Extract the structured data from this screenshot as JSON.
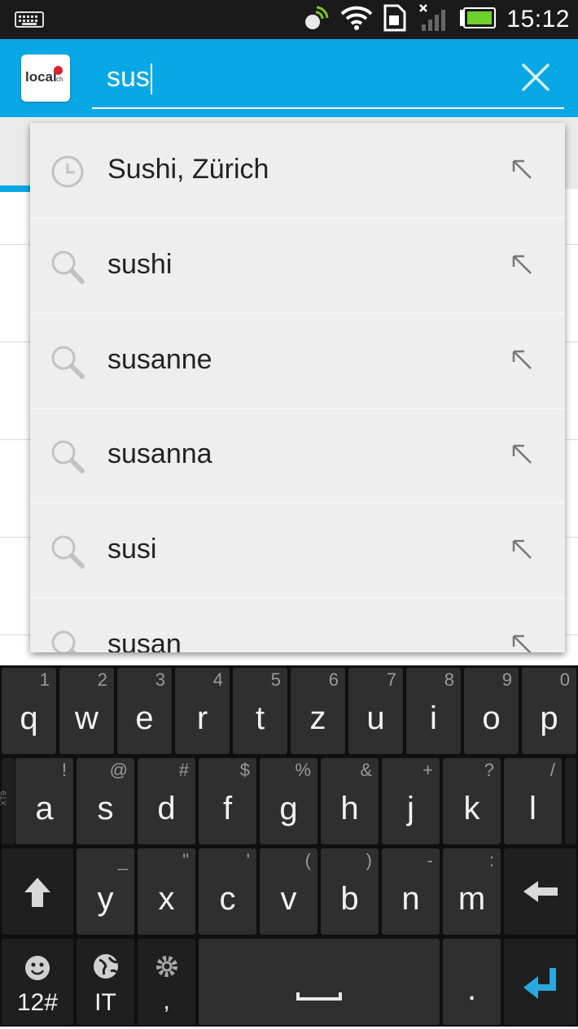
{
  "status_bar": {
    "time": "15:12",
    "icons": [
      "keyboard-icon",
      "nfc-icon",
      "wifi-icon",
      "sim-icon",
      "signal-icon",
      "battery-icon"
    ]
  },
  "search": {
    "value": "sus",
    "logo_text": "local",
    "logo_suffix": "ch"
  },
  "suggestions": [
    {
      "text": "Sushi, Zürich",
      "icon": "history-clock-icon"
    },
    {
      "text": "sushi",
      "icon": "search-icon"
    },
    {
      "text": "susanne",
      "icon": "search-icon"
    },
    {
      "text": "susanna",
      "icon": "search-icon"
    },
    {
      "text": "susi",
      "icon": "search-icon"
    },
    {
      "text": "susan",
      "icon": "search-icon"
    }
  ],
  "keyboard": {
    "row1": [
      {
        "k": "q",
        "h": "1"
      },
      {
        "k": "w",
        "h": "2"
      },
      {
        "k": "e",
        "h": "3"
      },
      {
        "k": "r",
        "h": "4"
      },
      {
        "k": "t",
        "h": "5"
      },
      {
        "k": "z",
        "h": "6"
      },
      {
        "k": "u",
        "h": "7"
      },
      {
        "k": "i",
        "h": "8"
      },
      {
        "k": "o",
        "h": "9"
      },
      {
        "k": "p",
        "h": "0"
      }
    ],
    "row2": [
      {
        "k": "a",
        "h": "!"
      },
      {
        "k": "s",
        "h": "@"
      },
      {
        "k": "d",
        "h": "#"
      },
      {
        "k": "f",
        "h": "$"
      },
      {
        "k": "g",
        "h": "%"
      },
      {
        "k": "h",
        "h": "&"
      },
      {
        "k": "j",
        "h": "+"
      },
      {
        "k": "k",
        "h": "?"
      },
      {
        "k": "l",
        "h": "/"
      }
    ],
    "row3": [
      {
        "k": "y",
        "h": "_"
      },
      {
        "k": "x",
        "h": "\""
      },
      {
        "k": "c",
        "h": "'"
      },
      {
        "k": "v",
        "h": "("
      },
      {
        "k": "b",
        "h": ")"
      },
      {
        "k": "n",
        "h": "-"
      },
      {
        "k": "m",
        "h": ":"
      }
    ],
    "xt9_label": "XT9",
    "symbols_label": "12#",
    "language_label": "IT",
    "comma_label": ",",
    "period_label": "."
  }
}
